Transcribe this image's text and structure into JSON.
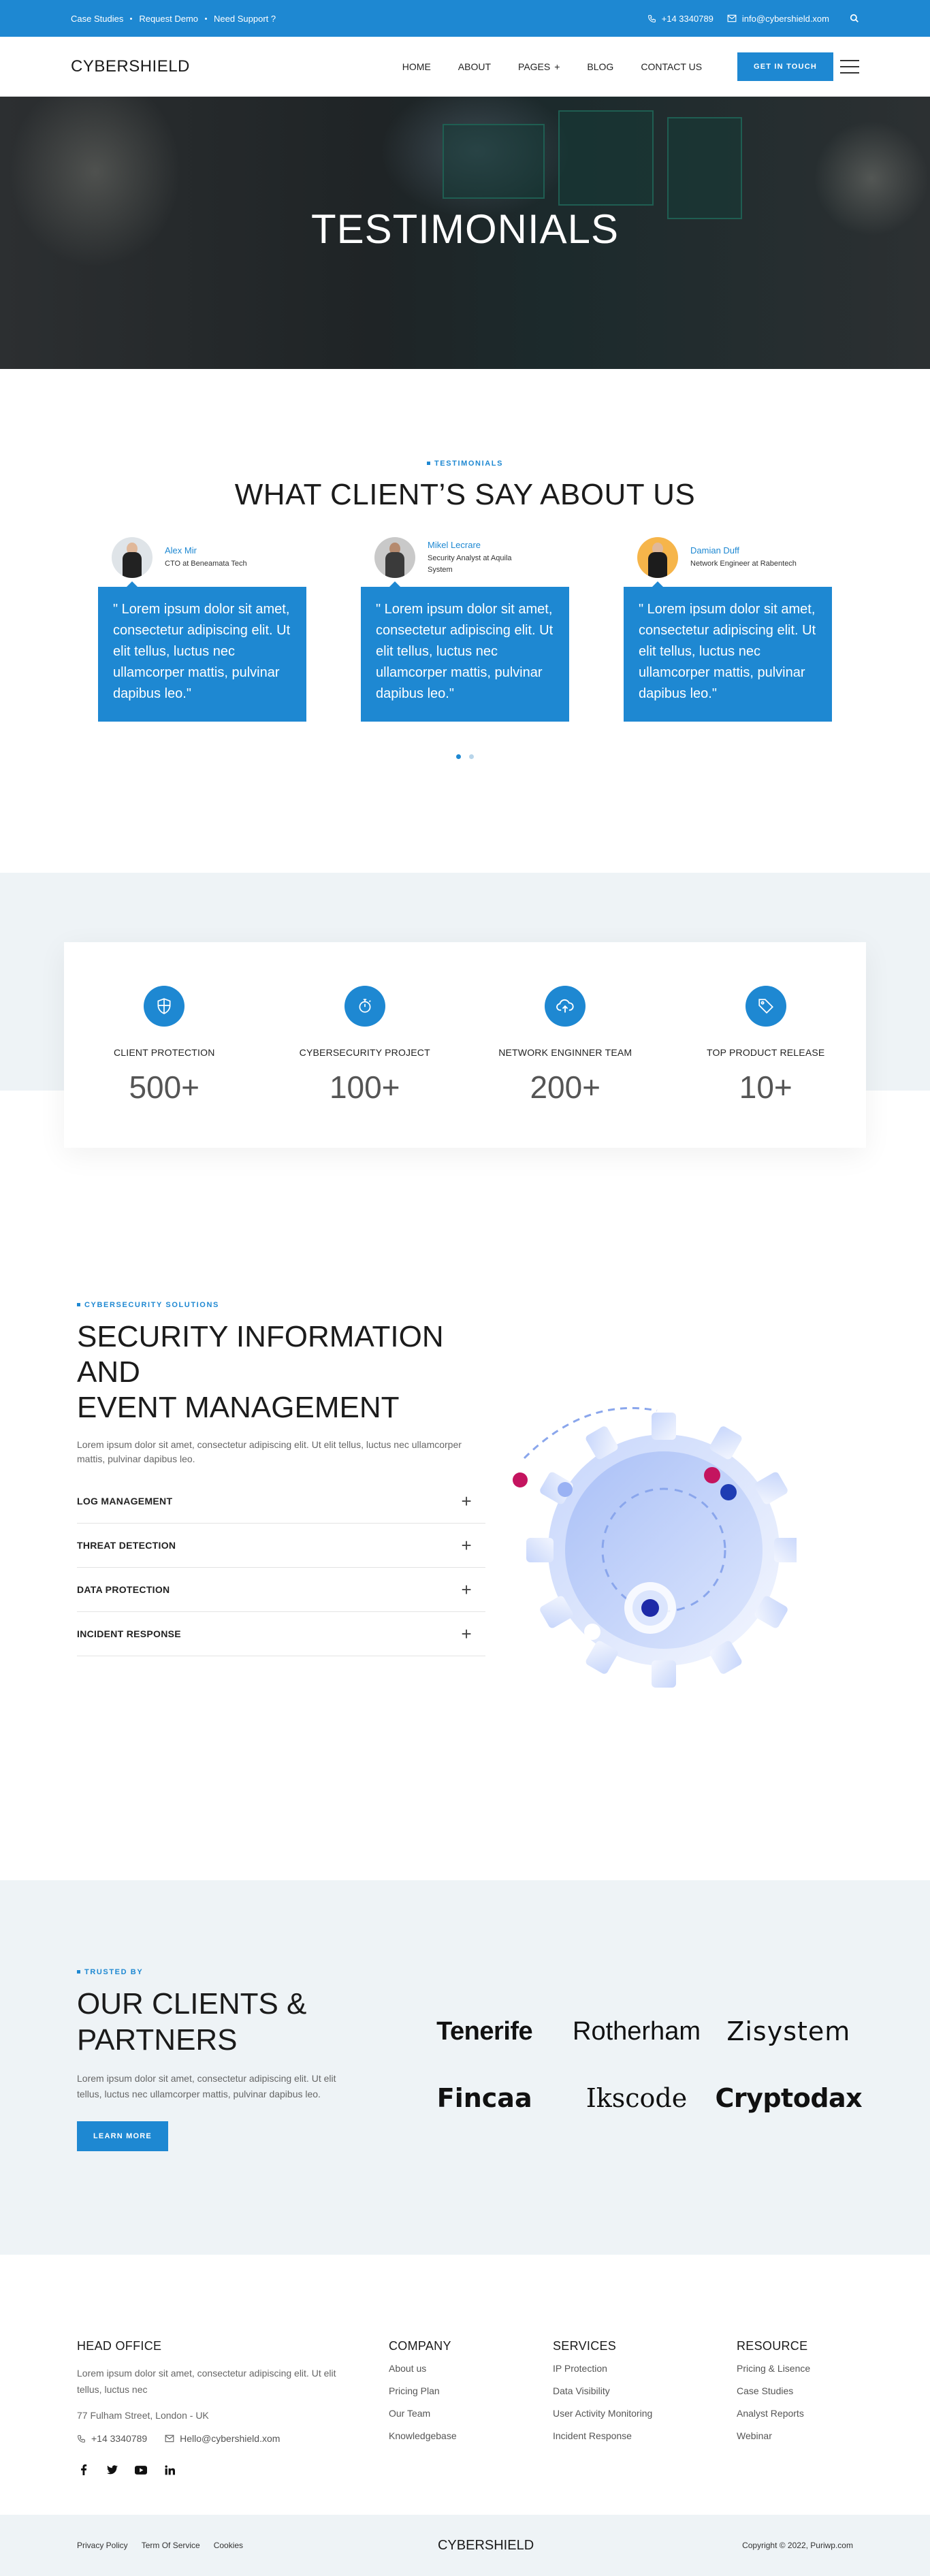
{
  "topbar": {
    "links": [
      "Case Studies",
      "Request Demo",
      "Need Support ?"
    ],
    "phone": "+14 3340789",
    "email": "info@cybershield.xom"
  },
  "header": {
    "logo": "CYBERSHIELD",
    "nav": [
      "HOME",
      "ABOUT",
      "PAGES",
      "BLOG",
      "CONTACT US"
    ],
    "cta": "GET IN TOUCH"
  },
  "hero": {
    "title": "TESTIMONIALS"
  },
  "testimonials": {
    "eyebrow": "TESTIMONIALS",
    "heading": "WHAT CLIENT’S SAY ABOUT US",
    "items": [
      {
        "name": "Alex Mir",
        "role": "CTO at Beneamata Tech",
        "quote": "\" Lorem ipsum dolor sit amet, consectetur adipiscing elit. Ut elit tellus, luctus nec ullamcorper mattis, pulvinar dapibus leo.\""
      },
      {
        "name": "Mikel Lecrare",
        "role": "Security Analyst at Aquila System",
        "quote": "\" Lorem ipsum dolor sit amet, consectetur adipiscing elit. Ut elit tellus, luctus nec ullamcorper mattis, pulvinar dapibus leo.\""
      },
      {
        "name": "Damian Duff",
        "role": "Network Engineer at Rabentech",
        "quote": "\" Lorem ipsum dolor sit amet, consectetur adipiscing elit. Ut elit tellus, luctus nec ullamcorper mattis, pulvinar dapibus leo.\""
      }
    ]
  },
  "stats": [
    {
      "label": "CLIENT PROTECTION",
      "value": "500+",
      "icon": "shield-icon"
    },
    {
      "label": "CYBERSECURITY PROJECT",
      "value": "100+",
      "icon": "stopwatch-icon"
    },
    {
      "label": "NETWORK ENGINNER TEAM",
      "value": "200+",
      "icon": "cloud-icon"
    },
    {
      "label": "TOP PRODUCT RELEASE",
      "value": "10+",
      "icon": "tag-icon"
    }
  ],
  "siem": {
    "eyebrow": "CYBERSECURITY SOLUTIONS",
    "heading_line1": "SECURITY INFORMATION AND",
    "heading_line2": "EVENT MANAGEMENT",
    "desc": "Lorem ipsum dolor sit amet, consectetur adipiscing elit. Ut elit tellus, luctus nec ullamcorper mattis, pulvinar dapibus leo.",
    "accordion": [
      "LOG MANAGEMENT",
      "THREAT DETECTION",
      "DATA PROTECTION",
      "INCIDENT RESPONSE"
    ]
  },
  "clients": {
    "eyebrow": "TRUSTED BY",
    "heading_line1": "OUR CLIENTS &",
    "heading_line2": "PARTNERS",
    "desc": "Lorem ipsum dolor sit amet, consectetur adipiscing elit. Ut elit tellus, luctus nec ullamcorper mattis, pulvinar dapibus leo.",
    "button": "LEARN MORE",
    "logos": [
      "Tenerife",
      "Rotherham",
      "Zisystem",
      "Fincaa",
      "Ikscode",
      "Cryptodax"
    ]
  },
  "footer": {
    "office": {
      "title": "HEAD OFFICE",
      "desc": "Lorem ipsum dolor sit amet, consectetur adipiscing elit. Ut elit tellus, luctus nec",
      "address": "77 Fulham Street, London - UK",
      "phone": "+14 3340789",
      "email": "Hello@cybershield.xom"
    },
    "company": {
      "title": "COMPANY",
      "links": [
        "About us",
        "Pricing Plan",
        "Our Team",
        "Knowledgebase"
      ]
    },
    "services": {
      "title": "SERVICES",
      "links": [
        "IP Protection",
        "Data Visibility",
        "User Activity Monitoring",
        "Incident Response"
      ]
    },
    "resource": {
      "title": "RESOURCE",
      "links": [
        "Pricing & Lisence",
        "Case Studies",
        "Analyst Reports",
        "Webinar"
      ]
    }
  },
  "bottombar": {
    "links": [
      "Privacy Policy",
      "Term Of Service",
      "Cookies"
    ],
    "logo": "CYBERSHIELD",
    "copyright": "Copyright © 2022, Puriwp.com"
  }
}
